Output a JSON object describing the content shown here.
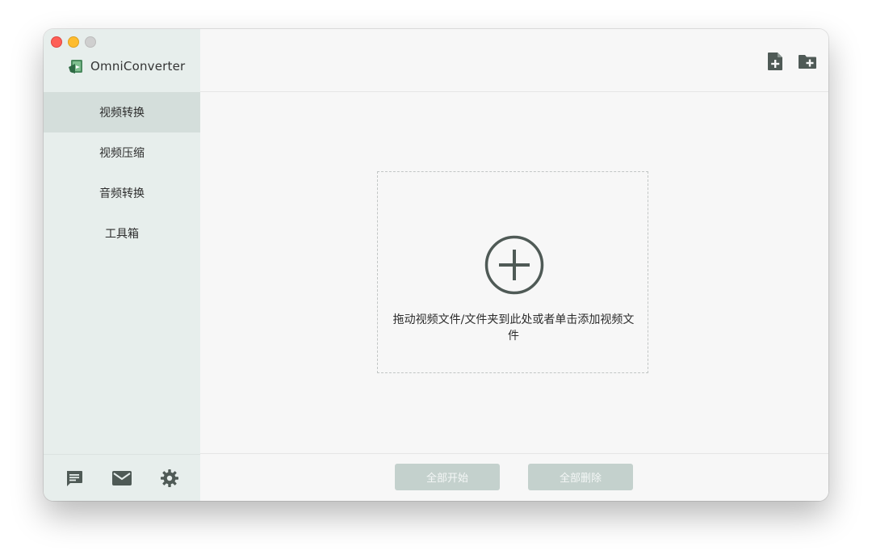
{
  "app": {
    "name": "OmniConverter"
  },
  "sidebar": {
    "items": [
      {
        "label": "视频转换",
        "active": true
      },
      {
        "label": "视频压缩",
        "active": false
      },
      {
        "label": "音频转换",
        "active": false
      },
      {
        "label": "工具箱",
        "active": false
      }
    ],
    "bottom_icons": [
      "chat-icon",
      "mail-icon",
      "gear-icon"
    ]
  },
  "toolbar": {
    "icons": [
      "add-file-icon",
      "add-folder-icon"
    ]
  },
  "dropzone": {
    "text": "拖动视频文件/文件夹到此处或者单击添加视频文件"
  },
  "footer": {
    "start_all_label": "全部开始",
    "delete_all_label": "全部删除"
  },
  "colors": {
    "accent": "#4f5a56",
    "sidebar_bg": "#e7eeec",
    "button_bg": "#c4d1cd"
  }
}
